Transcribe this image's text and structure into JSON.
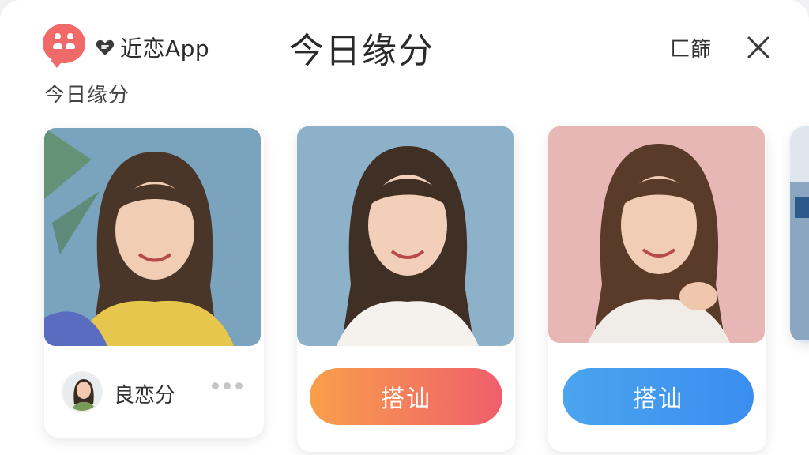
{
  "app": {
    "brand_name": "近恋App",
    "page_title": "今日缘分",
    "filter_label": "匚篩"
  },
  "section": {
    "subtitle": "今日缘分"
  },
  "cards": [
    {
      "name": "良恋分"
    },
    {
      "button_label": "搭讪"
    },
    {
      "button_label": "搭讪"
    }
  ],
  "colors": {
    "logo": "#f06a6a",
    "button_orange_start": "#f8a04a",
    "button_orange_end": "#f05e6c",
    "button_blue": "#3a8ef0"
  },
  "icons": [
    "logo-icon",
    "heart-chat-icon",
    "close-icon",
    "more-icon"
  ]
}
